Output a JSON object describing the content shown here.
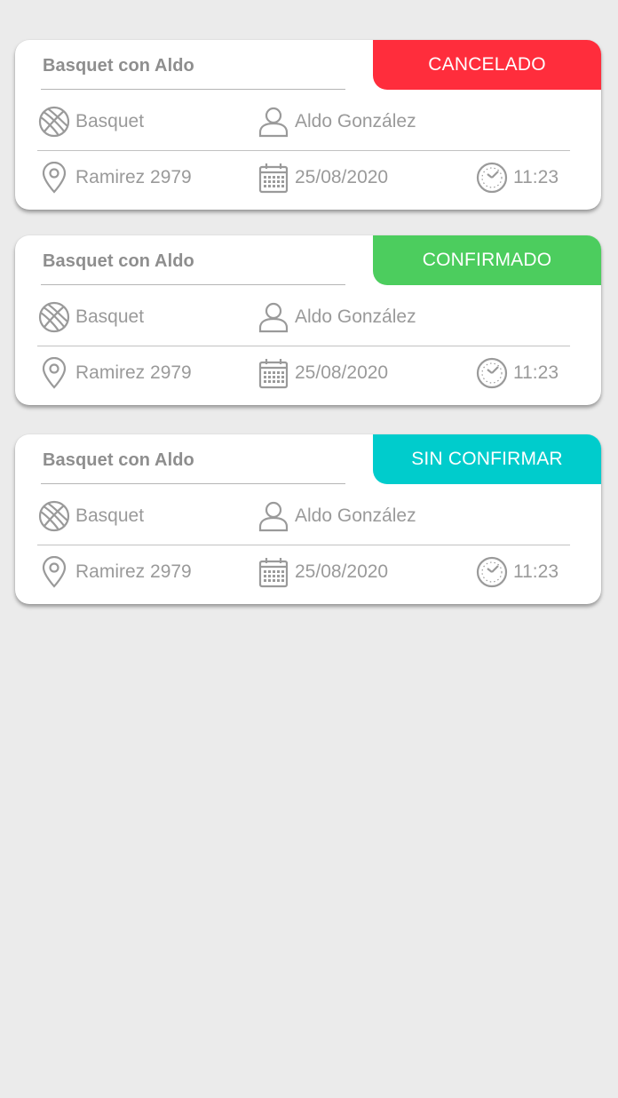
{
  "events": [
    {
      "title": "Basquet con Aldo",
      "status": "CANCELADO",
      "status_color": "#ff2d3c",
      "sport": "Basquet",
      "organizer": "Aldo González",
      "address": "Ramirez 2979",
      "date": "25/08/2020",
      "time": "11:23"
    },
    {
      "title": "Basquet con Aldo",
      "status": "CONFIRMADO",
      "status_color": "#4ccd5e",
      "sport": "Basquet",
      "organizer": "Aldo González",
      "address": "Ramirez 2979",
      "date": "25/08/2020",
      "time": "11:23"
    },
    {
      "title": "Basquet con Aldo",
      "status": "SIN CONFIRMAR",
      "status_color": "#00cccc",
      "sport": "Basquet",
      "organizer": "Aldo González",
      "address": "Ramirez 2979",
      "date": "25/08/2020",
      "time": "11:23"
    }
  ],
  "icons": {
    "sport": "basketball-icon",
    "organizer": "person-icon",
    "address": "location-pin-icon",
    "date": "calendar-icon",
    "time": "clock-icon"
  }
}
